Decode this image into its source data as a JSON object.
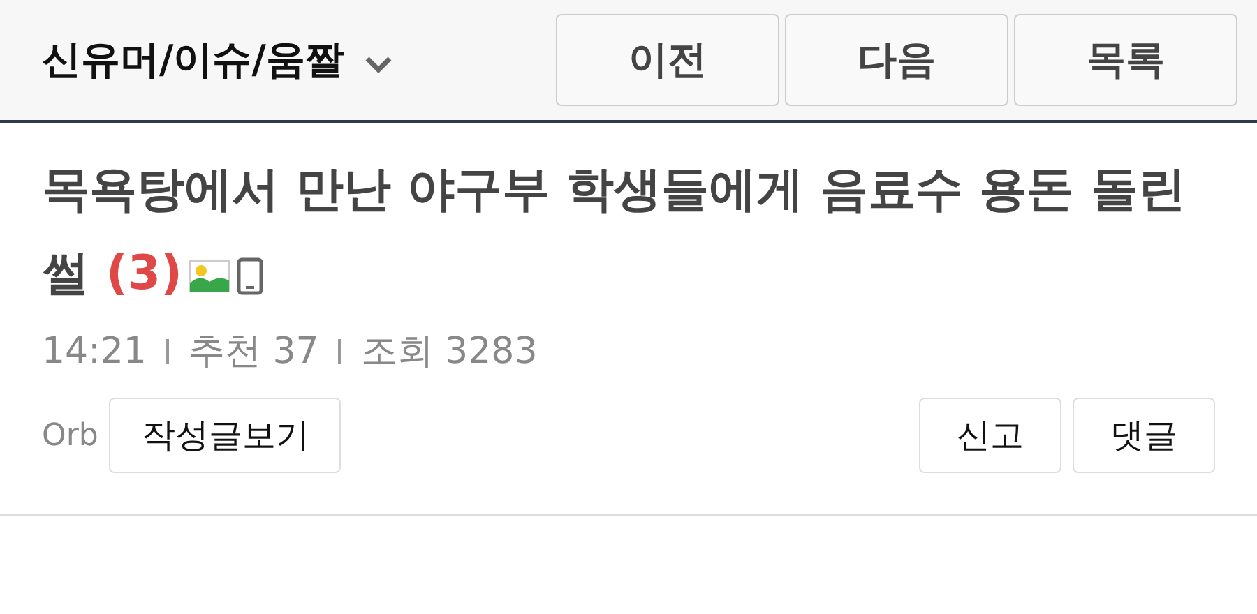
{
  "header": {
    "category": "신유머/이슈/움짤",
    "nav_buttons": [
      "이전",
      "다음",
      "목록"
    ]
  },
  "post": {
    "title": "목욕탕에서 만난 야구부 학생들에게 음료수 용돈 돌린 썰",
    "comment_count": "(3)",
    "has_image": true,
    "from_mobile": true,
    "meta": [
      "14:21",
      "추천 37",
      "조회 3283"
    ],
    "author": "Orb",
    "author_button": "작성글보기",
    "actions": [
      "신고",
      "댓글"
    ]
  }
}
